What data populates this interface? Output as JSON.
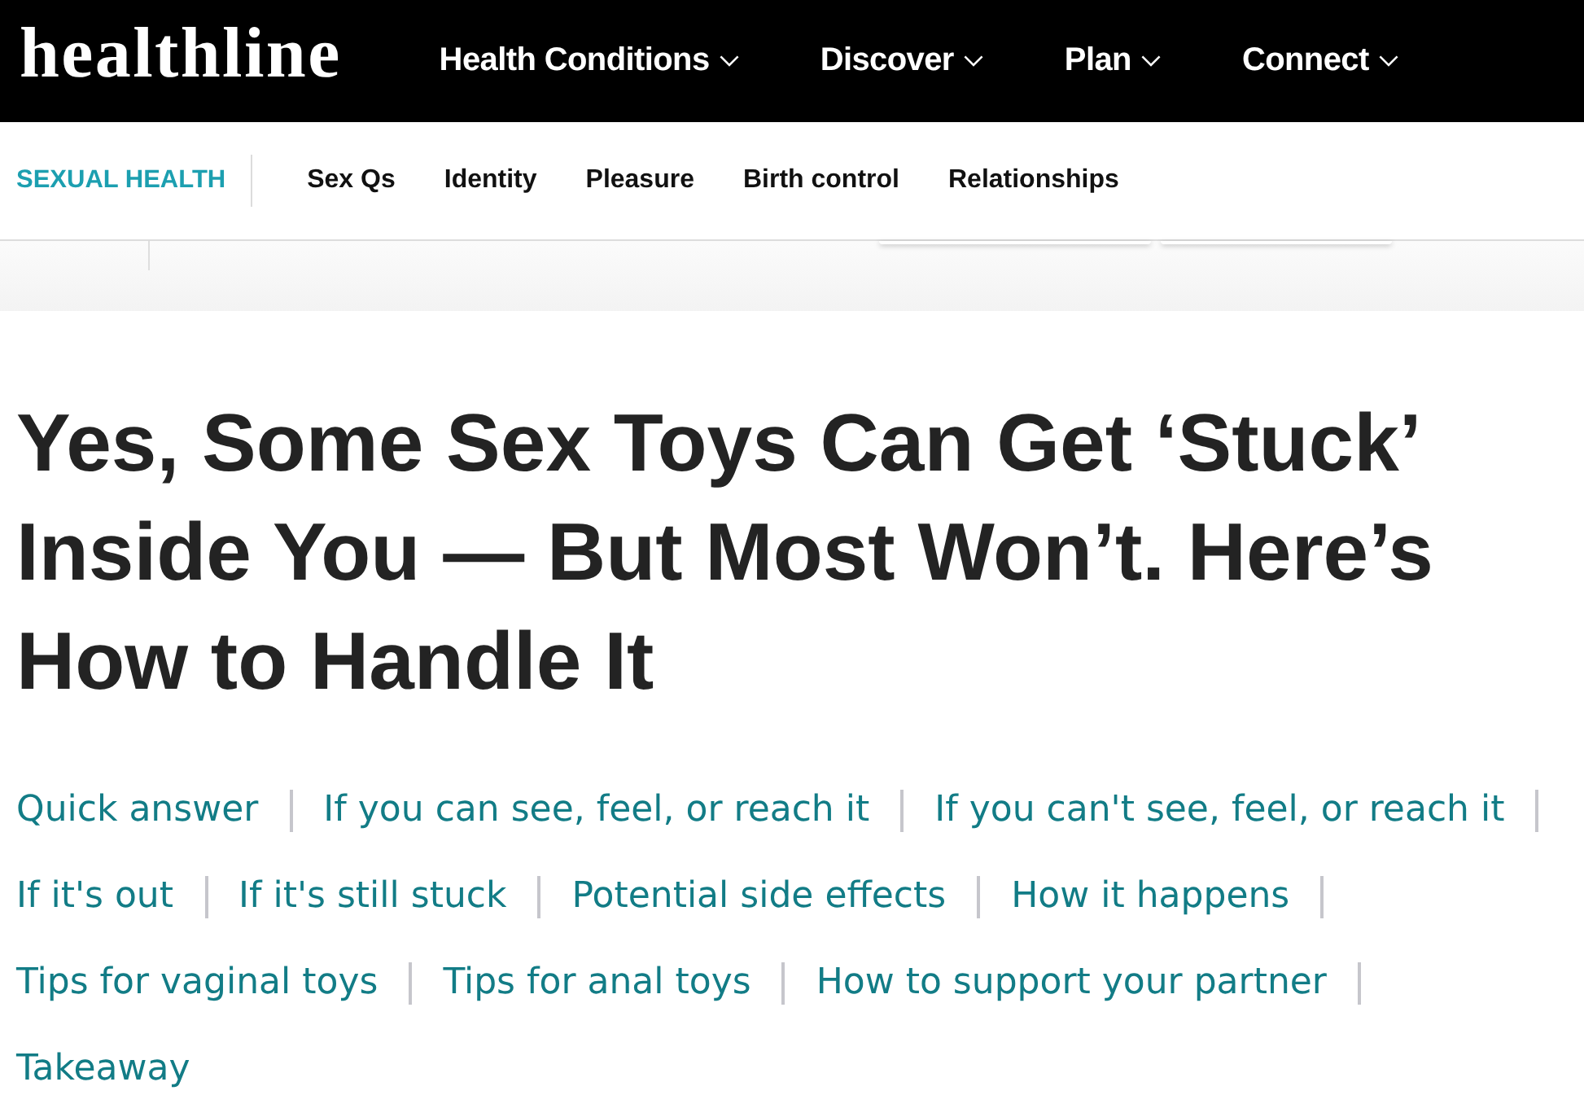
{
  "header": {
    "logo": "healthline",
    "nav": [
      {
        "label": "Health Conditions",
        "has_menu": true
      },
      {
        "label": "Discover",
        "has_menu": true
      },
      {
        "label": "Plan",
        "has_menu": true
      },
      {
        "label": "Connect",
        "has_menu": true
      }
    ]
  },
  "section_nav": {
    "title": "SEXUAL HEALTH",
    "items": [
      "Sex Qs",
      "Identity",
      "Pleasure",
      "Birth control",
      "Relationships"
    ]
  },
  "article": {
    "title": "Yes, Some Sex Toys Can Get ‘Stuck’ Inside You — But Most Won’t. Here’s How to Handle It",
    "contents": [
      "Quick answer",
      "If you can see, feel, or reach it",
      "If you can't see, feel, or reach it",
      "If it's out",
      "If it's still stuck",
      "Potential side effects",
      "How it happens",
      "Tips for vaginal toys",
      "Tips for anal toys",
      "How to support your partner",
      "Takeaway"
    ]
  }
}
